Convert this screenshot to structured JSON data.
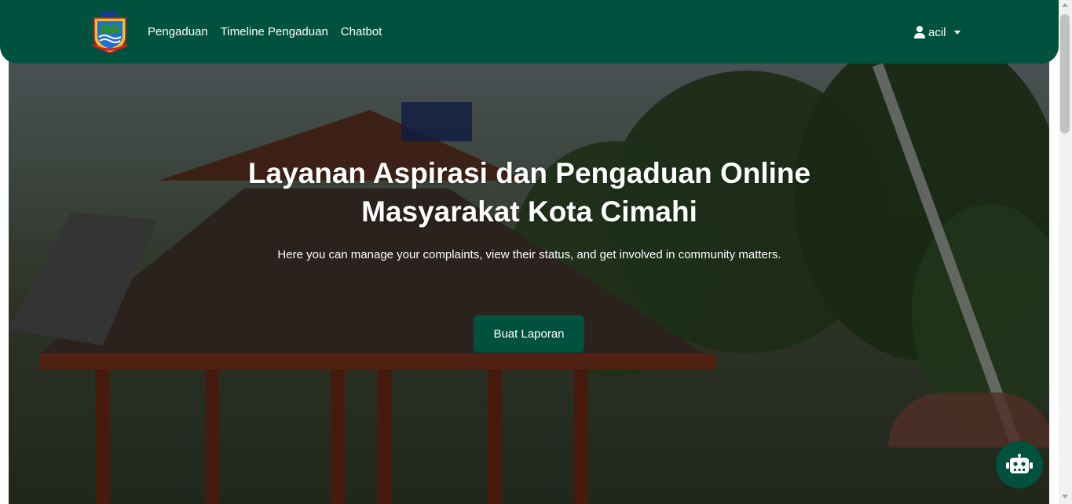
{
  "navbar": {
    "logo_icon": "cimahi-city-emblem",
    "links": [
      "Pengaduan",
      "Timeline Pengaduan",
      "Chatbot"
    ],
    "user": {
      "icon": "user-icon",
      "name": "acil",
      "dropdown_icon": "caret-down-icon"
    }
  },
  "hero": {
    "title_line1": "Layanan Aspirasi dan Pengaduan Online",
    "title_line2": "Masyarakat Kota Cimahi",
    "subtitle": "Here you can manage your complaints, view their status, and get involved in community matters.",
    "cta_label": "Buat Laporan",
    "background_icon": "dprd-building-photo"
  },
  "chatbot_button": {
    "icon": "robot-icon"
  },
  "colors": {
    "primary": "#00523f",
    "text_light": "#ffffff"
  }
}
